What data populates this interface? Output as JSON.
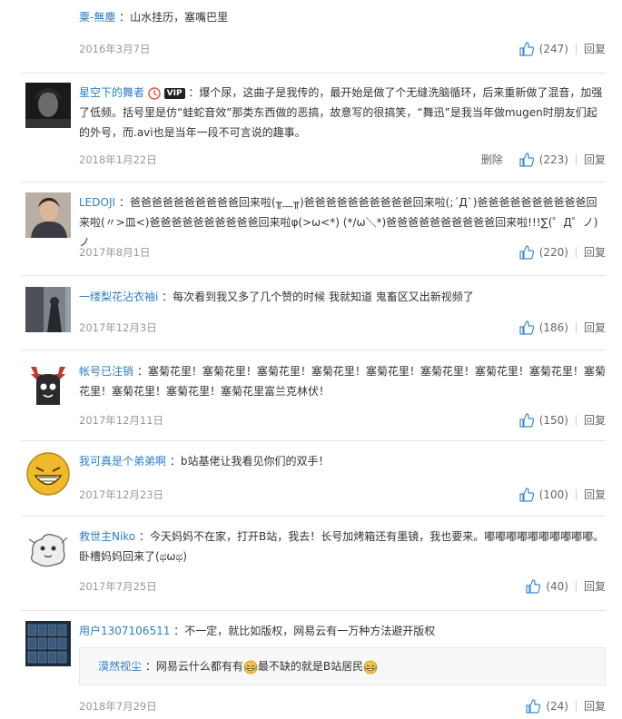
{
  "comments": [
    {
      "user": "粟-無塵",
      "text": "山水挂历，塞嘴巴里",
      "date": "2016年3月7日",
      "likes": "(247)",
      "reply": "回复"
    },
    {
      "user": "星空下的舞者",
      "text": "爆个尿，这曲子是我传的，最开始是做了个无缝洗脑循环，后来重新做了混音，加强了低频。括号里是仿“蛙蛇音效”那类东西做的恶搞，故意写的很搞笑，“舞迅”是我当年做mugen时朋友们起的外号，而.avi也是当年一段不可言说的趣事。",
      "date": "2018年1月22日",
      "delete": "删除",
      "likes": "(223)",
      "reply": "回复",
      "vip_label": "VIP"
    },
    {
      "user": "LEDOJI",
      "text": "爸爸爸爸爸爸爸爸爸爸回来啦(╥﹏╥)爸爸爸爸爸爸爸爸爸爸回来啦(;´Д`)爸爸爸爸爸爸爸爸爸爸回来啦(〃>皿<)爸爸爸爸爸爸爸爸爸爸回来啦φ(>ω<*) (*/ω＼*)爸爸爸爸爸爸爸爸爸爸回来啦!!!∑(゜Д゜ノ)ノ",
      "date": "2017年8月1日",
      "likes": "(220)",
      "reply": "回复"
    },
    {
      "user": "一缕梨花沾衣袖i",
      "text": "每次看到我又多了几个赞的时候 我就知道 鬼畜区又出新视频了",
      "date": "2017年12月3日",
      "likes": "(186)",
      "reply": "回复"
    },
    {
      "user": "帐号已注销",
      "text": "塞菊花里！塞菊花里！塞菊花里！塞菊花里！塞菊花里！塞菊花里！塞菊花里！塞菊花里！塞菊花里！塞菊花里！塞菊花里！塞菊花里富兰克林伏！",
      "date": "2017年12月11日",
      "likes": "(150)",
      "reply": "回复"
    },
    {
      "user": "我可真是个弟弟啊",
      "text": "b站基佬让我看见你们的双手！",
      "date": "2017年12月23日",
      "likes": "(100)",
      "reply": "回复"
    },
    {
      "user": "救世主Niko",
      "text": "今天妈妈不在家，打开B站，我去！长号加烤箱还有墨镜，我也要来。嘟嘟嘟嘟嘟嘟嘟嘟嘟嘟。卧槽妈妈回来了(ಥωಥ)",
      "date": "2017年7月25日",
      "likes": "(40)",
      "reply": "回复"
    },
    {
      "user": "用户1307106511",
      "text": "不一定，就比如版权，网易云有一万种方法避开版权",
      "date": "2018年7月29日",
      "likes": "(24)",
      "reply": "回复",
      "quote": {
        "user": "漠然视尘",
        "text_a": "网易云什么都有有",
        "text_b": "最不缺的就是B站居民"
      }
    }
  ],
  "colors": {
    "username": "#2b7ec6",
    "date": "#999999",
    "separator": "#e4e4e4"
  },
  "icons": [
    "thumb-up-icon",
    "vip-badge-icon",
    "crying-laugh-emoji-icon"
  ]
}
